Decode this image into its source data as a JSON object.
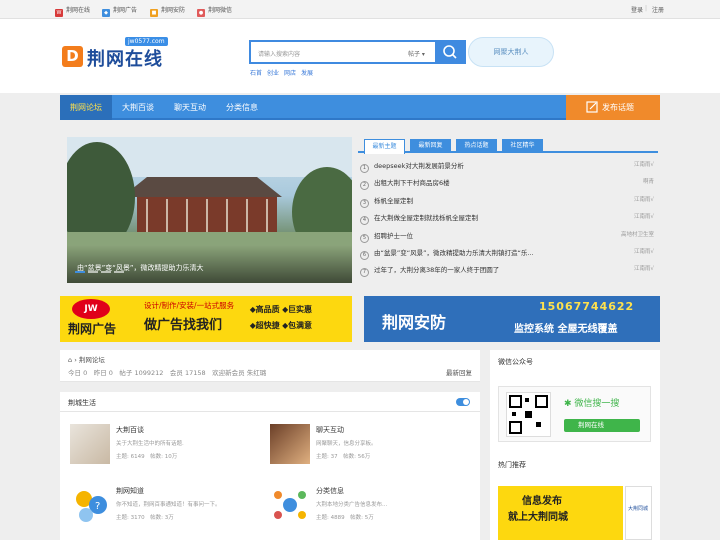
{
  "topbar": {
    "links": [
      "荆网在线",
      "荆网广告",
      "荆网安防",
      "荆网微信"
    ],
    "login": "登录",
    "sep": "|",
    "register": "注册"
  },
  "logo": {
    "letter": "D",
    "name": "荆网在线",
    "domain": "jw0577.com"
  },
  "search": {
    "placeholder": "请输入搜索内容",
    "scope": "帖子 ▾",
    "hot": [
      "石首",
      "创业",
      "网店",
      "发展"
    ]
  },
  "cloud_text": "网聚大荆人",
  "nav": {
    "items": [
      "荆网论坛",
      "大荆百谈",
      "聊天互动",
      "分类信息"
    ],
    "post": "发布话题"
  },
  "slider": {
    "caption": "由“盆景”变“风景”，微改精提助力乐清大"
  },
  "tabs": [
    "最新主题",
    "最新回复",
    "热点话题",
    "社区精华"
  ],
  "threads": [
    {
      "n": "1",
      "title": "deepseek对大荆发展前景分析",
      "author": "江南雨√"
    },
    {
      "n": "2",
      "title": "出租大荆下干村商品房6楼",
      "author": "啊青"
    },
    {
      "n": "3",
      "title": "栎帆全屋定制",
      "author": "江南雨√"
    },
    {
      "n": "4",
      "title": "在大荆做全屋定制就找栎帆全屋定制",
      "author": "江南雨√"
    },
    {
      "n": "5",
      "title": "招聘护士一位",
      "author": "高地村卫生室"
    },
    {
      "n": "6",
      "title": "由“盆景”变“风景”，微改精提助力乐清大荆镇打造“乐...",
      "author": "江南雨√"
    },
    {
      "n": "7",
      "title": "过年了，大荆分离38年的一家人终于团圆了",
      "author": "江南雨√"
    }
  ],
  "ads": {
    "left_brand": "荆网广告",
    "left_line1": "设计/制作/安装/一站式服务",
    "left_big": "做广告找我们",
    "left_tags": [
      "高品质",
      "巨实惠",
      "超快捷",
      "包满意"
    ],
    "right_title": "荆网安防",
    "right_phone": "15067744622",
    "right_line": "监控系统 全屋无线覆盖"
  },
  "forum": {
    "breadcrumb": "荆网论坛",
    "stats": "今日 0　昨日 0　帖子 1099212　会员 17158　欢迎新会员 朱红璐",
    "latest": "最新回复"
  },
  "section": {
    "title": "荆城生活",
    "boards": [
      {
        "title": "大荆百谈",
        "desc": "关于大荆生活中的所有话题.",
        "stats": "主题: 6149　帖数: 10万"
      },
      {
        "title": "聊天互动",
        "desc": "网聚聊天，信息分享板。",
        "stats": "主题: 37　帖数: 56万"
      },
      {
        "title": "荆网知道",
        "desc": "你不知道，荆网百事通知道！有事问一下。",
        "stats": "主题: 3170　帖数: 3万"
      },
      {
        "title": "分类信息",
        "desc": "大荆本地分类广告信息发布...",
        "stats": "主题: 4889　帖数: 5万"
      }
    ]
  },
  "sidebar": {
    "wechat_title": "微信公众号",
    "wechat_search": "微信搜一搜",
    "wechat_name": "荆网在线",
    "hot_title": "热门推荐",
    "promo_line1": "信息发布",
    "promo_line2": "就上大荆同城",
    "promo_side": "大荆同城"
  },
  "colors": {
    "nav": "#3e8ede",
    "accent": "#f08a2b",
    "ad_yellow": "#fdd80f"
  }
}
